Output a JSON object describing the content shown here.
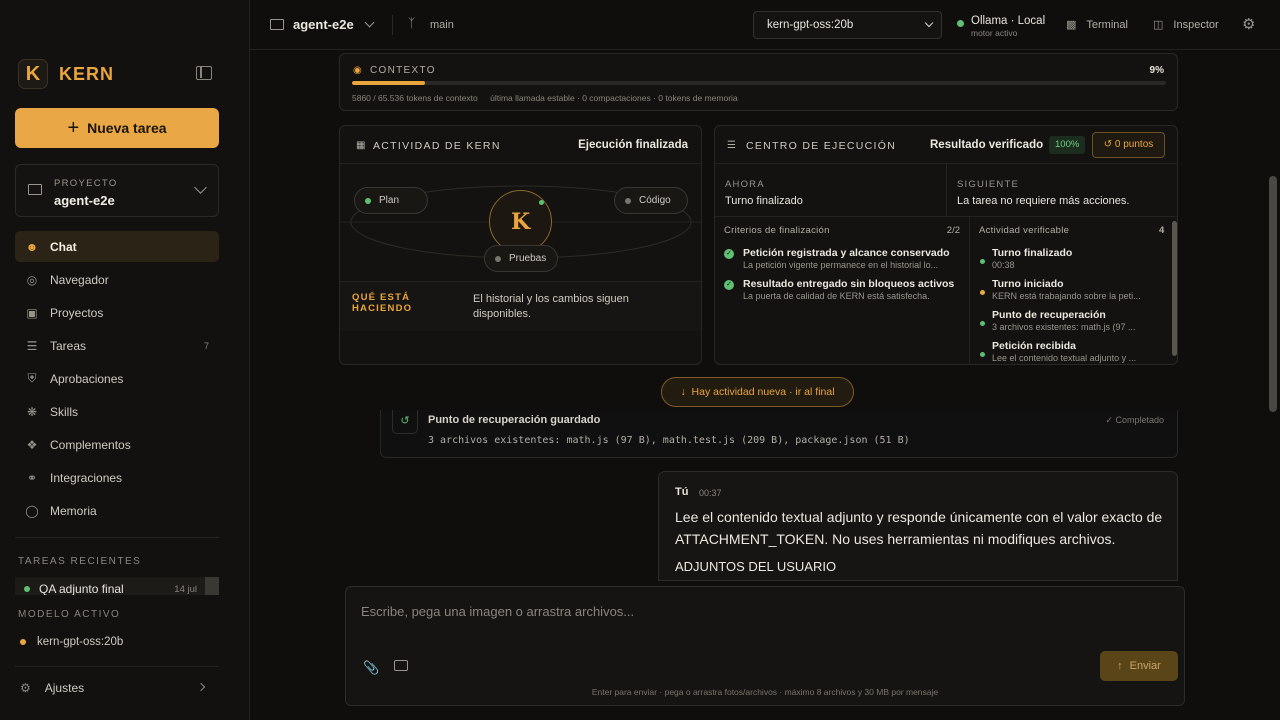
{
  "brand": {
    "letter": "K",
    "name": "KERN"
  },
  "sidebar": {
    "new_task": "Nueva tarea",
    "project_label": "PROYECTO",
    "project_name": "agent-e2e",
    "nav": [
      {
        "label": "Chat",
        "icon": "chat-icon",
        "active": true
      },
      {
        "label": "Navegador",
        "icon": "globe-icon"
      },
      {
        "label": "Proyectos",
        "icon": "folder-icon"
      },
      {
        "label": "Tareas",
        "icon": "checklist-icon",
        "badge": "7"
      },
      {
        "label": "Aprobaciones",
        "icon": "shield-check-icon"
      },
      {
        "label": "Skills",
        "icon": "brain-icon"
      },
      {
        "label": "Complementos",
        "icon": "puzzle-icon"
      },
      {
        "label": "Integraciones",
        "icon": "plug-icon"
      },
      {
        "label": "Memoria",
        "icon": "memory-icon"
      }
    ],
    "recent_title": "TAREAS RECIENTES",
    "recent": [
      {
        "name": "QA adjunto final",
        "date": "14 jul"
      }
    ],
    "active_model_title": "MODELO ACTIVO",
    "active_model": "kern-gpt-oss:20b",
    "settings": "Ajustes"
  },
  "topbar": {
    "project": "agent-e2e",
    "branch": "main",
    "model": "kern-gpt-oss:20b",
    "engine_name": "Ollama · Local",
    "engine_status": "motor activo",
    "terminal": "Terminal",
    "inspector": "Inspector"
  },
  "context": {
    "title": "CONTEXTO",
    "percent_label": "9%",
    "percent": 9,
    "tokens": "5860 / 65.536 tokens de contexto",
    "status": "última llamada estable · 0 compactaciones · 0 tokens de memoria"
  },
  "activity": {
    "title": "ACTIVIDAD DE KERN",
    "status": "Ejecución finalizada",
    "nodes": {
      "plan": "Plan",
      "code": "Código",
      "tests": "Pruebas"
    },
    "core": "K",
    "doing_label": "QUÉ ESTÁ HACIENDO",
    "doing_text": "El historial y los cambios siguen disponibles."
  },
  "execution": {
    "title": "CENTRO DE EJECUCIÓN",
    "status": "Resultado verificado",
    "percent": "100%",
    "points": "0 puntos",
    "now_label": "AHORA",
    "now_value": "Turno finalizado",
    "next_label": "SIGUIENTE",
    "next_value": "La tarea no requiere más acciones.",
    "criteria_title": "Criterios de finalización",
    "criteria_count": "2/2",
    "criteria": [
      {
        "title": "Petición registrada y alcance conservado",
        "desc": "La petición vigente permanece en el historial lo..."
      },
      {
        "title": "Resultado entregado sin bloqueos activos",
        "desc": "La puerta de calidad de KERN está satisfecha."
      }
    ],
    "activity_title": "Actividad verificable",
    "activity_count": "4",
    "activity": [
      {
        "title": "Turno finalizado",
        "desc": "00:38",
        "color": "#5fbf73"
      },
      {
        "title": "Turno iniciado",
        "desc": "KERN está trabajando sobre la peti...",
        "color": "#e9a845"
      },
      {
        "title": "Punto de recuperación",
        "desc": "3 archivos existentes: math.js (97 ...",
        "color": "#5fbf73"
      },
      {
        "title": "Petición recibida",
        "desc": "Lee el contenido textual adjunto y ...",
        "color": "#5fbf73"
      }
    ]
  },
  "new_activity": "Hay actividad nueva · ir al final",
  "recovery": {
    "title": "Punto de recuperación guardado",
    "status": "Completado",
    "detail": "3 archivos existentes: math.js (97 B), math.test.js (209 B), package.json (51 B)"
  },
  "message": {
    "author": "Tú",
    "time": "00:37",
    "body": "Lee el contenido textual adjunto y responde únicamente con el valor exacto de ATTACHMENT_TOKEN. No uses herramientas ni modifiques archivos.",
    "attachments": "ADJUNTOS DEL USUARIO"
  },
  "composer": {
    "placeholder": "Escribe, pega una imagen o arrastra archivos...",
    "send": "Enviar",
    "hint": "Enter para enviar · pega o arrastra fotos/archivos · máximo 8 archivos y 30 MB por mensaje"
  },
  "colors": {
    "accent": "#e9a845",
    "success": "#5fbf73",
    "background": "#0f0e0d"
  }
}
